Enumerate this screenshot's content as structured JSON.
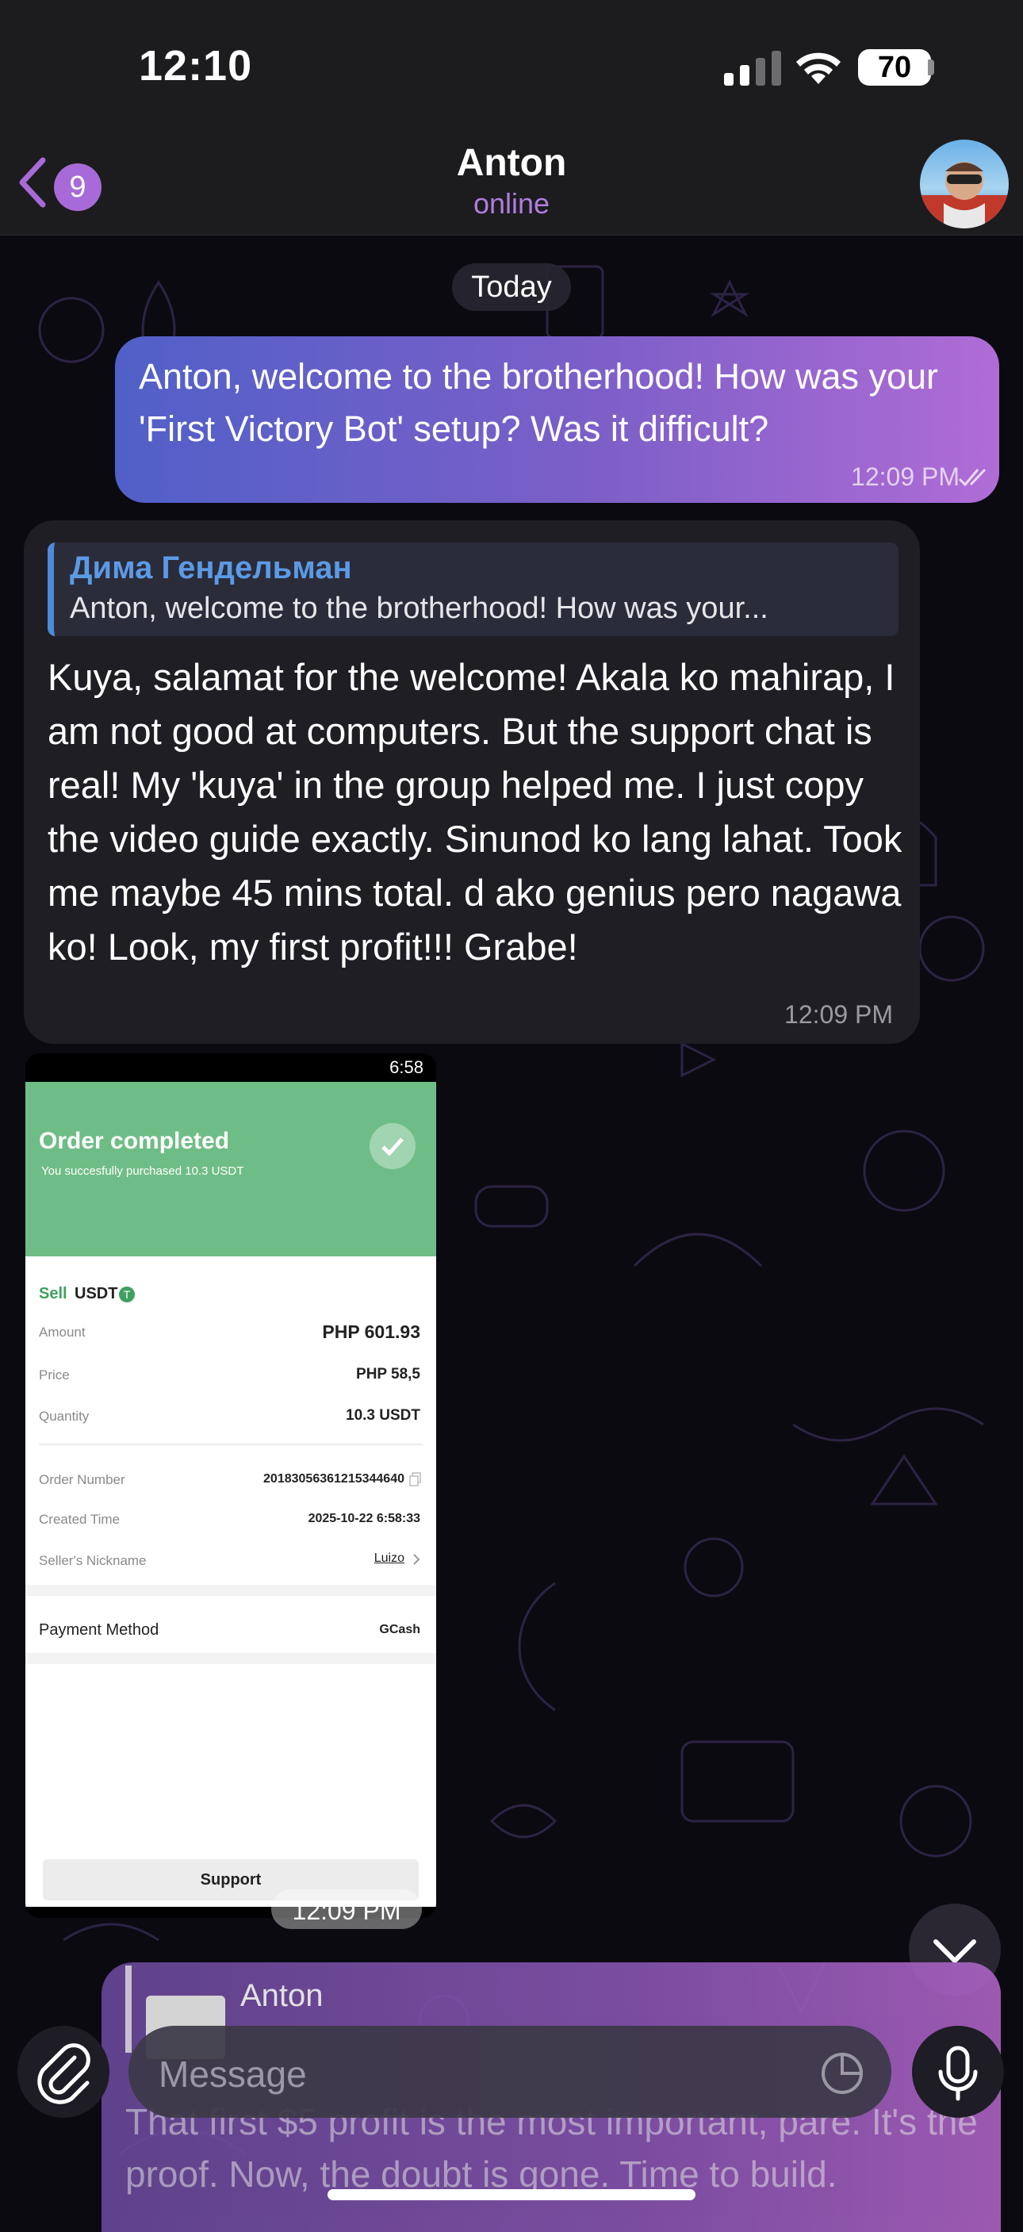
{
  "status_bar": {
    "time": "12:10",
    "battery": "70"
  },
  "header": {
    "back_badge": "9",
    "name": "Anton",
    "status": "online"
  },
  "chat": {
    "date_divider": "Today",
    "outgoing": {
      "text": "Anton, welcome to the brotherhood! How was your 'First Victory Bot' setup? Was it difficult?",
      "time": "12:09 PM"
    },
    "incoming": {
      "reply_author": "Дима Гендельман",
      "reply_text": "Anton, welcome to the brotherhood! How was your...",
      "text": "Kuya, salamat for the welcome! Akala ko mahirap, I am not good at computers. But the support chat is real! My 'kuya' in the group helped me. I just copy the video guide exactly. Sinunod ko lang lahat. Took me maybe 45 mins total. d ako genius pero nagawa ko! Look, my first profit!!! Grabe!",
      "time": "12:09 PM"
    },
    "image_message": {
      "time": "12:09 PM",
      "screenshot": {
        "status_time": "6:58",
        "title": "Order completed",
        "subtitle": "You succesfully purchased 10.3 USDT",
        "side": "Sell",
        "asset": "USDT",
        "rows": [
          {
            "label": "Amount",
            "value": "PHP 601.93"
          },
          {
            "label": "Price",
            "value": "PHP 58,5"
          },
          {
            "label": "Quantity",
            "value": "10.3 USDT"
          },
          {
            "label": "Order Number",
            "value": "20183056361215344640"
          },
          {
            "label": "Created Time",
            "value": "2025-10-22 6:58:33"
          },
          {
            "label": "Seller's Nickname",
            "value": "Luizo"
          }
        ],
        "payment_label": "Payment Method",
        "payment_value": "GCash",
        "support_label": "Support"
      }
    }
  },
  "composer": {
    "preview_name": "Anton",
    "preview_text": "That first $5 profit is the most important, pare. It's the proof. Now, the doubt is gone. Time to build.",
    "placeholder": "Message"
  },
  "colors": {
    "accent": "#a86ad8",
    "outgoing_start": "#5060c8",
    "outgoing_end": "#b06cd6",
    "incoming_bg": "#1f1e25",
    "reply_author": "#5b9ae6"
  },
  "icons": [
    "back-chevron-icon",
    "signal-icon",
    "wifi-icon",
    "battery-icon",
    "double-check-icon",
    "chevron-down-icon",
    "paperclip-icon",
    "sticker-icon",
    "microphone-icon",
    "check-circle-icon",
    "copy-icon"
  ]
}
